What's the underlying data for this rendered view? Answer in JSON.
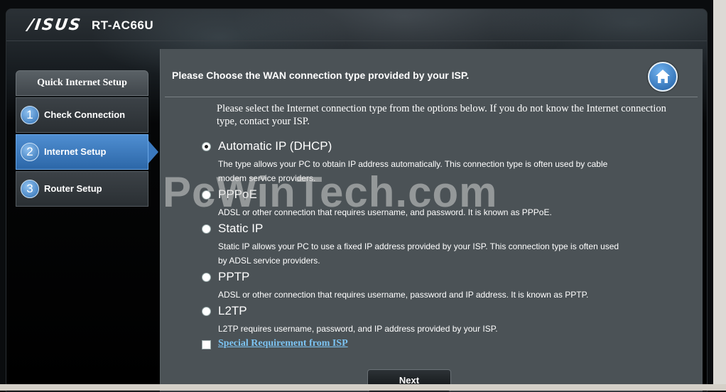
{
  "header": {
    "logo": "/ISUS",
    "model": "RT-AC66U"
  },
  "sidebar": {
    "title": "Quick Internet Setup",
    "steps": [
      {
        "num": "1",
        "label": "Check Connection"
      },
      {
        "num": "2",
        "label": "Internet Setup"
      },
      {
        "num": "3",
        "label": "Router Setup"
      }
    ]
  },
  "panel": {
    "title": "Please Choose the WAN connection type provided by your ISP.",
    "intro": "Please select the Internet connection type from the options below. If you do not know the Internet connection type, contact your ISP.",
    "options": [
      {
        "label": "Automatic IP (DHCP)",
        "desc": "The type allows your PC to obtain IP address automatically. This connection type is often used by cable modem service providers."
      },
      {
        "label": "PPPoE",
        "desc": "ADSL or other connection that requires username, and password. It is known as PPPoE."
      },
      {
        "label": "Static IP",
        "desc": "Static IP allows your PC to use a fixed IP address provided by your ISP. This connection type is often used by ADSL service providers."
      },
      {
        "label": "PPTP",
        "desc": "ADSL or other connection that requires username, password and IP address. It is known as PPTP."
      },
      {
        "label": "L2TP",
        "desc": "L2TP requires username, password, and IP address provided by your ISP."
      }
    ],
    "special": "Special Requirement from ISP",
    "next": "Next"
  },
  "watermark": "PcWinTech.com"
}
